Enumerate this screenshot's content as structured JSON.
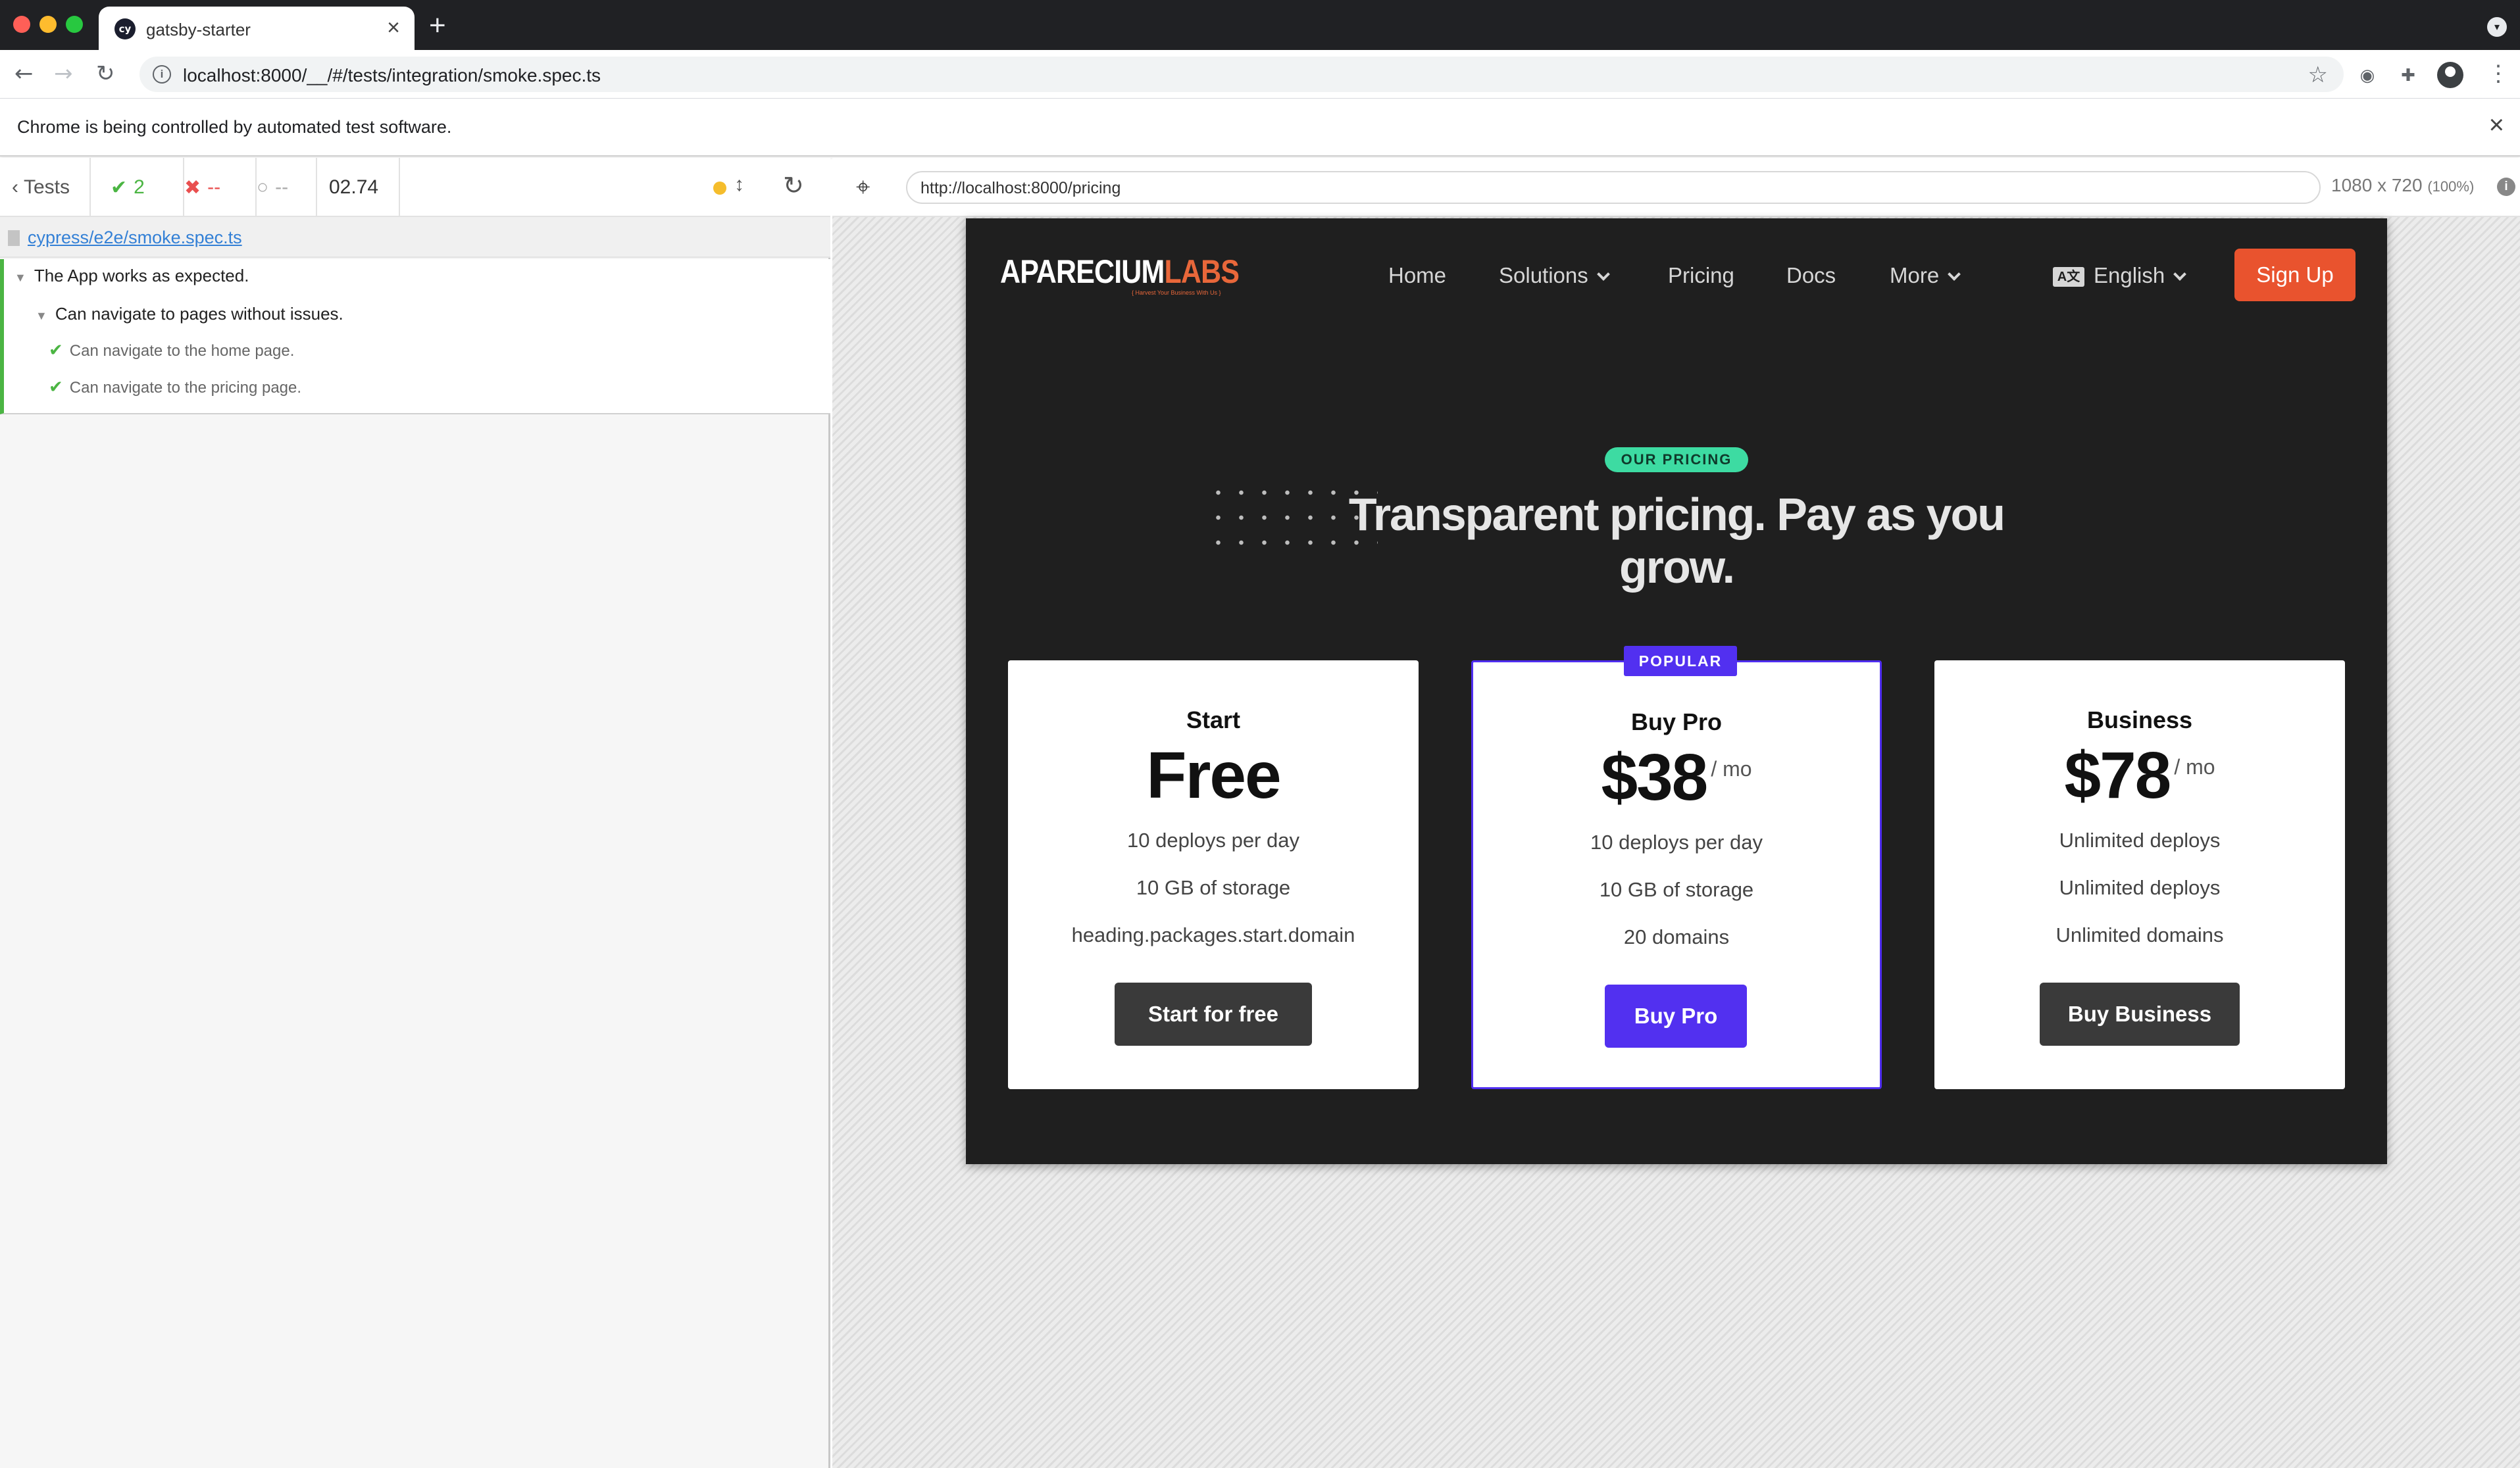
{
  "browser": {
    "tab_title": "gatsby-starter",
    "tab_favicon": "cy",
    "url": "localhost:8000/__/#/tests/integration/smoke.spec.ts",
    "infobar_text": "Chrome is being controlled by automated test software."
  },
  "reporter": {
    "tests_label": "Tests",
    "passed_count": "2",
    "failed_count": "--",
    "pending_count": "--",
    "duration": "02.74",
    "spec_file": "cypress/e2e/smoke.spec.ts",
    "suite_title": "The App works as expected.",
    "sub_suite_title": "Can navigate to pages without issues.",
    "tests": [
      {
        "title": "Can navigate to the home page.",
        "status": "passed"
      },
      {
        "title": "Can navigate to the pricing page.",
        "status": "passed"
      }
    ]
  },
  "aut": {
    "url": "http://localhost:8000/pricing",
    "viewport": "1080 x 720",
    "scale": "(100%)"
  },
  "site": {
    "logo_primary": "APARECIUM",
    "logo_secondary": "LABS",
    "logo_tagline": "{ Harvest Your Business With Us }",
    "nav": {
      "home": "Home",
      "solutions": "Solutions",
      "pricing": "Pricing",
      "docs": "Docs",
      "more": "More",
      "language_icon": "A文",
      "language": "English"
    },
    "signup": "Sign Up",
    "badge": "OUR PRICING",
    "headline": "Transparent pricing. Pay as you grow.",
    "popular_badge": "POPULAR",
    "plans": [
      {
        "name": "Start",
        "price": "Free",
        "period": "",
        "features": [
          "10 deploys per day",
          "10 GB of storage",
          "heading.packages.start.domain"
        ],
        "cta": "Start for free"
      },
      {
        "name": "Buy Pro",
        "price": "$38",
        "period": "/ mo",
        "features": [
          "10 deploys per day",
          "10 GB of storage",
          "20 domains"
        ],
        "cta": "Buy Pro"
      },
      {
        "name": "Business",
        "price": "$78",
        "period": "/ mo",
        "features": [
          "Unlimited deploys",
          "Unlimited deploys",
          "Unlimited domains"
        ],
        "cta": "Buy Business"
      }
    ]
  },
  "colors": {
    "accent_orange": "#e9532e",
    "accent_purple": "#5230f0",
    "badge_green": "#3ddba2",
    "pass_green": "#4bb543",
    "fail_red": "#e94f4f"
  }
}
